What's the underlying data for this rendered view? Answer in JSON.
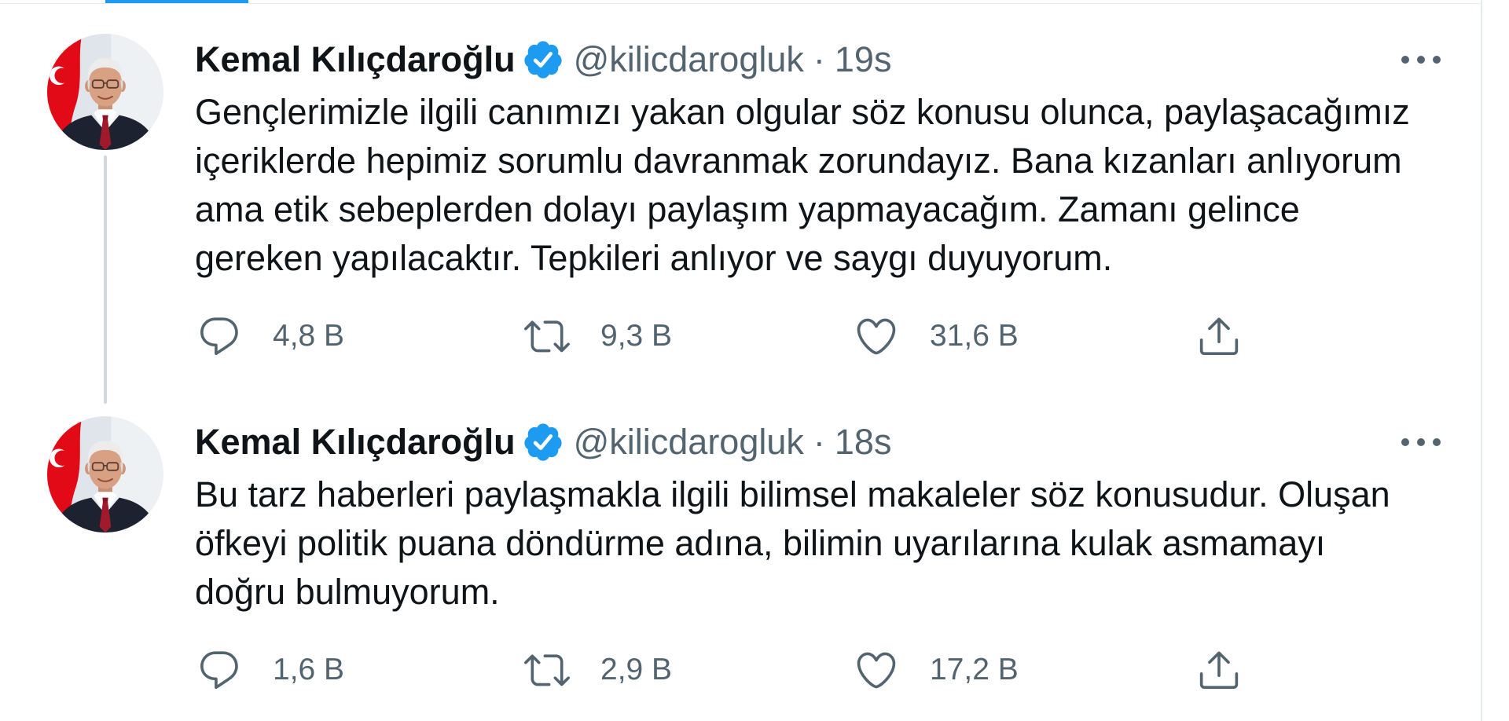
{
  "colors": {
    "text": "#0f1419",
    "secondary": "#536471",
    "accent": "#1d9bf0",
    "thread": "#cfd9de",
    "border": "#e7ecf0"
  },
  "tweets": [
    {
      "author": {
        "name": "Kemal Kılıçdaroğlu",
        "handle": "@kilicdarogluk",
        "verified": true,
        "avatar_icon": "avatar-photo",
        "badge_icon": "verified-badge-icon"
      },
      "separator": "·",
      "time": "19s",
      "more_icon": "more-horizontal-icon",
      "text_lines": [
        "Gençlerimizle ilgili canımızı yakan olgular söz konusu olunca, paylaşacağımız",
        "içeriklerde hepimiz sorumlu davranmak zorundayız. Bana kızanları anlıyorum",
        "ama etik sebeplerden dolayı paylaşım yapmayacağım. Zamanı gelince",
        "gereken yapılacaktır. Tepkileri anlıyor ve saygı duyuyorum."
      ],
      "actions": {
        "reply": {
          "icon": "reply-icon",
          "count": "4,8 B"
        },
        "retweet": {
          "icon": "retweet-icon",
          "count": "9,3 B"
        },
        "like": {
          "icon": "heart-icon",
          "count": "31,6 B"
        },
        "share": {
          "icon": "share-icon"
        }
      }
    },
    {
      "author": {
        "name": "Kemal Kılıçdaroğlu",
        "handle": "@kilicdarogluk",
        "verified": true,
        "avatar_icon": "avatar-photo",
        "badge_icon": "verified-badge-icon"
      },
      "separator": "·",
      "time": "18s",
      "more_icon": "more-horizontal-icon",
      "text_lines": [
        "Bu tarz haberleri paylaşmakla ilgili bilimsel makaleler söz konusudur. Oluşan",
        "öfkeyi politik puana döndürme adına, bilimin uyarılarına kulak asmamayı",
        "doğru bulmuyorum."
      ],
      "actions": {
        "reply": {
          "icon": "reply-icon",
          "count": "1,6 B"
        },
        "retweet": {
          "icon": "retweet-icon",
          "count": "2,9 B"
        },
        "like": {
          "icon": "heart-icon",
          "count": "17,2 B"
        },
        "share": {
          "icon": "share-icon"
        }
      }
    }
  ]
}
